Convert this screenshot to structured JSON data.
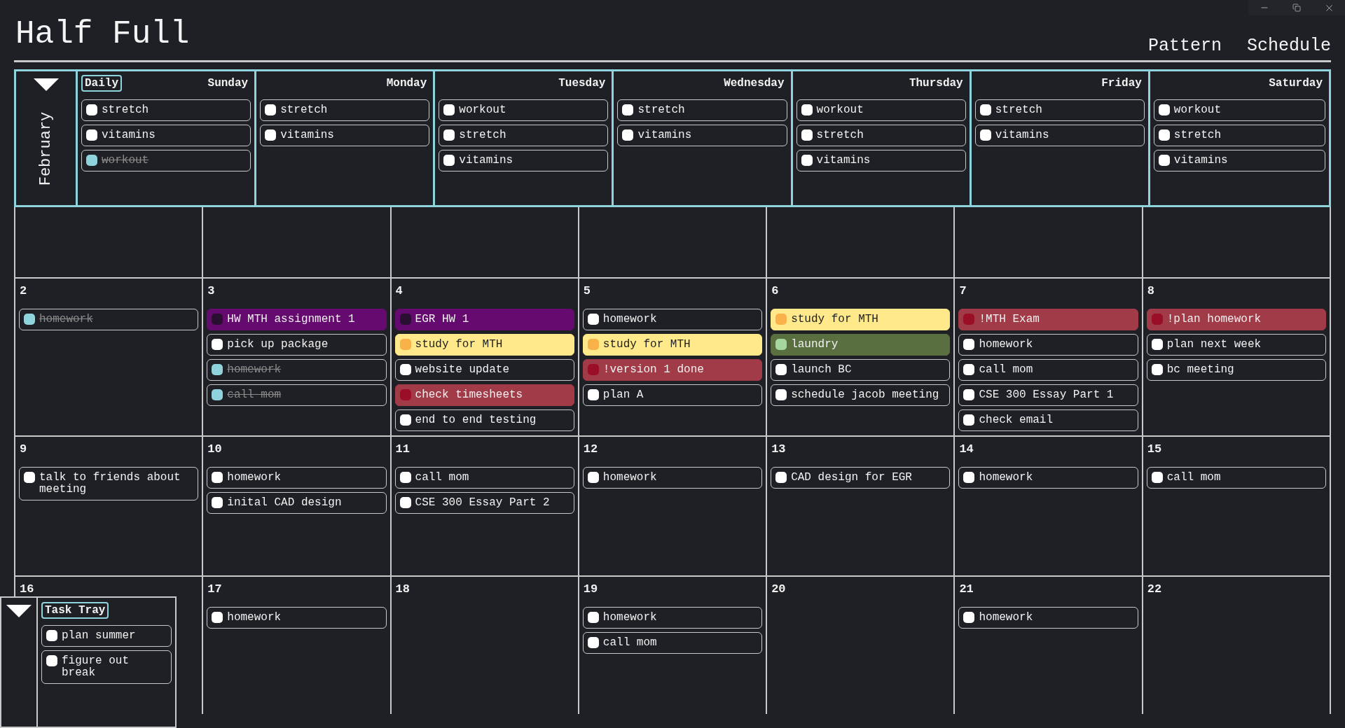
{
  "window": {
    "title": "Half Full",
    "nav": [
      {
        "label": "Pattern"
      },
      {
        "label": "Schedule"
      }
    ]
  },
  "daily": {
    "month": "February",
    "tag": "Daily",
    "expanded": true,
    "columns": [
      {
        "day": "Sunday",
        "tasks": [
          {
            "text": "stretch",
            "done": false
          },
          {
            "text": "vitamins",
            "done": false
          },
          {
            "text": "workout",
            "done": true
          }
        ]
      },
      {
        "day": "Monday",
        "tasks": [
          {
            "text": "stretch",
            "done": false
          },
          {
            "text": "vitamins",
            "done": false
          }
        ]
      },
      {
        "day": "Tuesday",
        "tasks": [
          {
            "text": "workout",
            "done": false
          },
          {
            "text": "stretch",
            "done": false
          },
          {
            "text": "vitamins",
            "done": false
          }
        ]
      },
      {
        "day": "Wednesday",
        "tasks": [
          {
            "text": "stretch",
            "done": false
          },
          {
            "text": "vitamins",
            "done": false
          }
        ]
      },
      {
        "day": "Thursday",
        "tasks": [
          {
            "text": "workout",
            "done": false
          },
          {
            "text": "stretch",
            "done": false
          },
          {
            "text": "vitamins",
            "done": false
          }
        ]
      },
      {
        "day": "Friday",
        "tasks": [
          {
            "text": "stretch",
            "done": false
          },
          {
            "text": "vitamins",
            "done": false
          }
        ]
      },
      {
        "day": "Saturday",
        "tasks": [
          {
            "text": "workout",
            "done": false
          },
          {
            "text": "stretch",
            "done": false
          },
          {
            "text": "vitamins",
            "done": false
          }
        ]
      }
    ]
  },
  "weeks": [
    {
      "kind": "blank"
    },
    {
      "kind": "days",
      "days": [
        {
          "date": "2",
          "tasks": [
            {
              "text": "homework",
              "done": true
            }
          ]
        },
        {
          "date": "3",
          "tasks": [
            {
              "text": "HW MTH assignment 1",
              "done": false,
              "color": "#650a6e"
            },
            {
              "text": "pick up package",
              "done": false
            },
            {
              "text": "homework",
              "done": true
            },
            {
              "text": "call mom",
              "done": true
            }
          ]
        },
        {
          "date": "4",
          "tasks": [
            {
              "text": "EGR HW 1",
              "done": false,
              "color": "#650a6e"
            },
            {
              "text": "study for MTH",
              "done": false,
              "color": "#ffe98a"
            },
            {
              "text": "website update",
              "done": false
            },
            {
              "text": "check timesheets",
              "done": false,
              "color": "#a23b48"
            },
            {
              "text": "end to end testing",
              "done": false
            }
          ]
        },
        {
          "date": "5",
          "tasks": [
            {
              "text": "homework",
              "done": false
            },
            {
              "text": "study for MTH",
              "done": false,
              "color": "#ffe98a"
            },
            {
              "text": "!version 1 done",
              "done": false,
              "color": "#a23b48"
            },
            {
              "text": "plan A",
              "done": false
            }
          ]
        },
        {
          "date": "6",
          "tasks": [
            {
              "text": "study for MTH",
              "done": false,
              "color": "#ffe98a"
            },
            {
              "text": "laundry",
              "done": false,
              "color": "#596f3f"
            },
            {
              "text": "launch BC",
              "done": false
            },
            {
              "text": "schedule jacob meeting",
              "done": false
            }
          ]
        },
        {
          "date": "7",
          "tasks": [
            {
              "text": "!MTH Exam",
              "done": false,
              "color": "#a23b48"
            },
            {
              "text": "homework",
              "done": false
            },
            {
              "text": "call mom",
              "done": false
            },
            {
              "text": "CSE 300 Essay Part 1",
              "done": false
            },
            {
              "text": "check email",
              "done": false
            }
          ]
        },
        {
          "date": "8",
          "tasks": [
            {
              "text": "!plan homework",
              "done": false,
              "color": "#a23b48"
            },
            {
              "text": "plan next week",
              "done": false
            },
            {
              "text": "bc meeting",
              "done": false
            }
          ]
        }
      ]
    },
    {
      "kind": "days",
      "days": [
        {
          "date": "9",
          "tasks": [
            {
              "text": "talk to friends about meeting",
              "done": false
            }
          ]
        },
        {
          "date": "10",
          "tasks": [
            {
              "text": "homework",
              "done": false
            },
            {
              "text": "inital CAD design",
              "done": false
            }
          ]
        },
        {
          "date": "11",
          "tasks": [
            {
              "text": "call mom",
              "done": false
            },
            {
              "text": "CSE 300 Essay Part 2",
              "done": false
            }
          ]
        },
        {
          "date": "12",
          "tasks": [
            {
              "text": "homework",
              "done": false
            }
          ]
        },
        {
          "date": "13",
          "tasks": [
            {
              "text": "CAD design for EGR",
              "done": false
            }
          ]
        },
        {
          "date": "14",
          "tasks": [
            {
              "text": "homework",
              "done": false
            }
          ]
        },
        {
          "date": "15",
          "tasks": [
            {
              "text": "call mom",
              "done": false
            }
          ]
        }
      ]
    },
    {
      "kind": "days",
      "days": [
        {
          "date": "16"
        },
        {
          "date": "17",
          "tasks": [
            {
              "text": "homework",
              "done": false
            }
          ]
        },
        {
          "date": "18"
        },
        {
          "date": "19",
          "tasks": [
            {
              "text": "homework",
              "done": false
            },
            {
              "text": "call mom",
              "done": false
            }
          ]
        },
        {
          "date": "20"
        },
        {
          "date": "21",
          "tasks": [
            {
              "text": "homework",
              "done": false
            }
          ]
        },
        {
          "date": "22"
        }
      ]
    }
  ],
  "task_tray": {
    "title": "Task Tray",
    "expanded": true,
    "tasks": [
      {
        "text": "plan summer",
        "done": false
      },
      {
        "text": "figure out break",
        "done": false
      }
    ]
  }
}
